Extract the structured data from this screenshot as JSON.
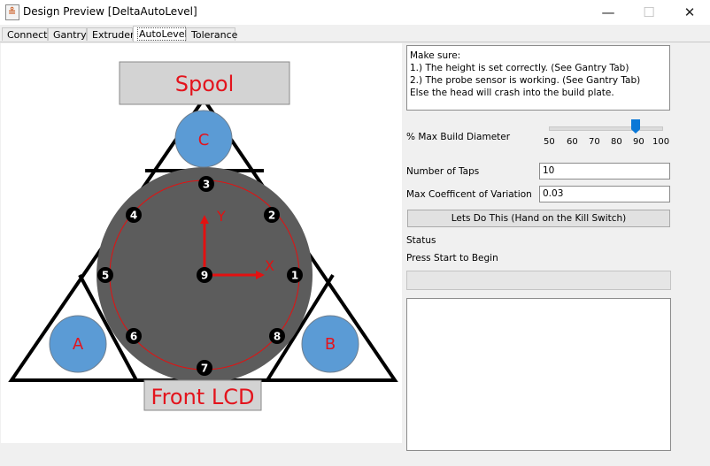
{
  "window": {
    "title": "Design Preview [DeltaAutoLevel]",
    "minimize_glyph": "—",
    "maximize_glyph": "☐",
    "close_glyph": "✕",
    "app_icon_glyph": "≗"
  },
  "tabs": [
    {
      "label": "Connect",
      "active": false
    },
    {
      "label": "Gantry",
      "active": false
    },
    {
      "label": "Extruder",
      "active": false
    },
    {
      "label": "AutoLevel",
      "active": true
    },
    {
      "label": "Tolerance",
      "active": false
    }
  ],
  "diagram": {
    "top_label": "Spool",
    "bottom_label": "Front LCD",
    "towers": [
      "A",
      "B",
      "C"
    ],
    "points": [
      "1",
      "2",
      "3",
      "4",
      "5",
      "6",
      "7",
      "8",
      "9"
    ],
    "axis_x": "X",
    "axis_y": "Y",
    "colors": {
      "label_box": "#d3d3d3",
      "label_text": "#e3141d",
      "bed": "#5c5c5c",
      "tower": "#5b9bd5",
      "axis": "#e31111",
      "marker": "#000000"
    }
  },
  "instructions": [
    "Make sure:",
    "1.) The height is set correctly. (See Gantry Tab)",
    "2.) The probe sensor is working. (See Gantry Tab)",
    "Else the head will crash into the build plate."
  ],
  "build_diameter": {
    "label": "% Max Build Diameter",
    "value": 90,
    "ticks": [
      "50",
      "60",
      "70",
      "80",
      "90",
      "100"
    ]
  },
  "taps": {
    "label": "Number of Taps",
    "value": "10"
  },
  "variation": {
    "label": "Max Coefficent of Variation",
    "value": "0.03"
  },
  "start_button": "Lets Do This (Hand on the Kill Switch)",
  "status": {
    "label": "Status",
    "message": "Press Start to Begin",
    "progress": 0
  }
}
